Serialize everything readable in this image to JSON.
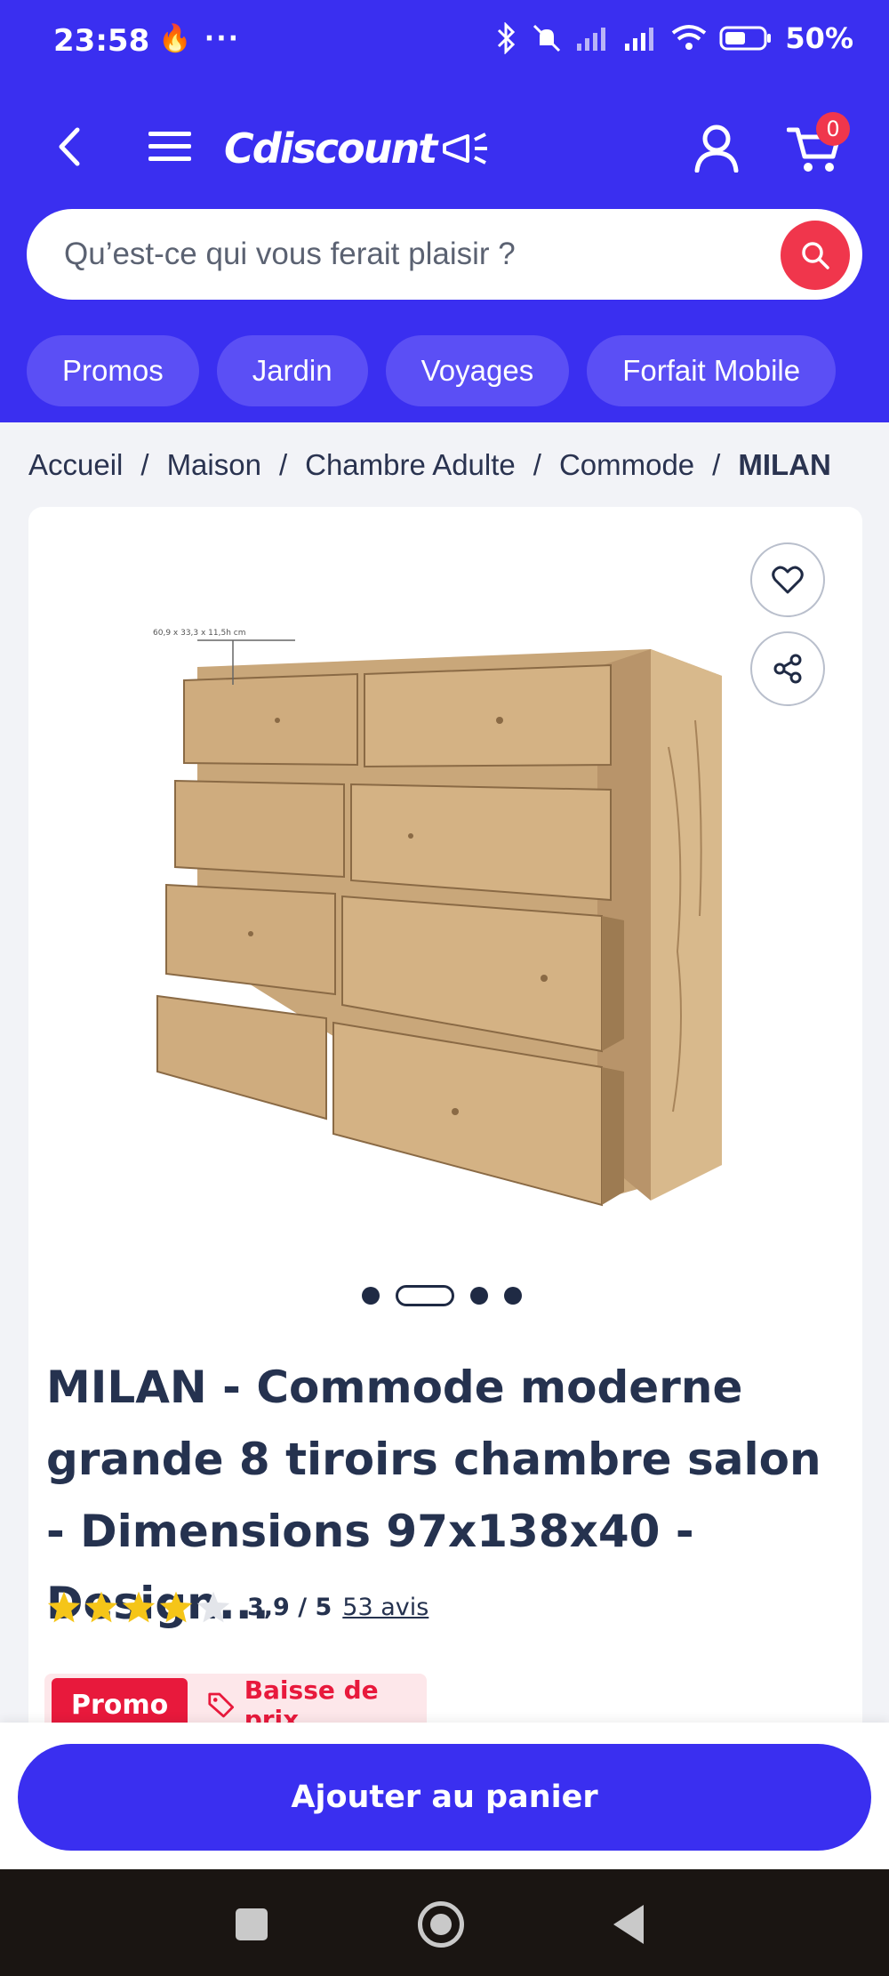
{
  "status": {
    "time": "23:58",
    "extra": "🔥 ···",
    "battery": "50%"
  },
  "header": {
    "logo": "Cdiscount",
    "cart_count": "0",
    "search_placeholder": "Qu’est-ce qui vous ferait plaisir ?",
    "chips": [
      "Promos",
      "Jardin",
      "Voyages",
      "Forfait Mobile"
    ]
  },
  "breadcrumb": [
    "Accueil",
    "Maison",
    "Chambre Adulte",
    "Commode",
    "MILAN"
  ],
  "product": {
    "image_label": "60,9 x 33,3 x 11,5h cm",
    "title": "MILAN - Commode moderne grande 8 tiroirs chambre salon - Dimensions 97x138x40 - Design...",
    "rating": 3.9,
    "rating_text": "3,9 / 5",
    "review_count": "53 avis",
    "promo_badge": "Promo",
    "price_drop": "Baisse de prix",
    "carousel": {
      "count": 4,
      "active": 2
    }
  },
  "actions": {
    "add_to_cart": "Ajouter au panier"
  },
  "colors": {
    "brand": "#3a2ff0",
    "accent": "#f0364c",
    "star": "#f5c518"
  }
}
